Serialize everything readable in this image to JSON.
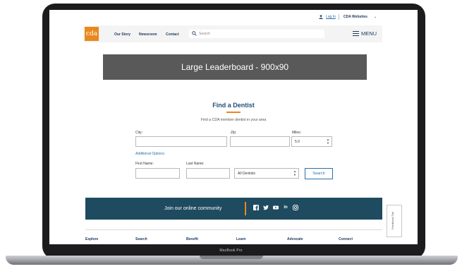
{
  "device_label": "MacBook Pro",
  "topbar": {
    "login_label": "Log In",
    "websites_label": "CDA Websites"
  },
  "navbar": {
    "logo_text": "cda",
    "items": [
      "Our Story",
      "Newsroom",
      "Contact"
    ],
    "search_placeholder": "Search",
    "menu_label": "MENU"
  },
  "leaderboard": {
    "text": "Large Leaderboard - 900x90"
  },
  "find": {
    "title": "Find a Dentist",
    "subtitle": "Find a CDA member dentist in your area",
    "city_label": "City:",
    "zip_label": "Zip:",
    "miles_label": "Miles:",
    "miles_value": "5.0",
    "additional_options": "Additional Options:",
    "first_name_label": "First Name:",
    "last_name_label": "Last Name:",
    "dentist_type_value": "All Dentists",
    "search_button": "Search"
  },
  "community": {
    "text": "Join our online community",
    "social_icons": [
      "facebook",
      "twitter",
      "youtube",
      "linkedin",
      "instagram"
    ]
  },
  "footer": {
    "items": [
      "Explore",
      "Search",
      "Benefit",
      "Learn",
      "Advocate",
      "Connect"
    ]
  },
  "feedback": {
    "label": "Feedback Tab"
  },
  "colors": {
    "accent": "#e8891d",
    "brand_blue": "#1d4f7a",
    "community_bg": "#1e4b5f",
    "leaderboard_bg": "#595959"
  }
}
